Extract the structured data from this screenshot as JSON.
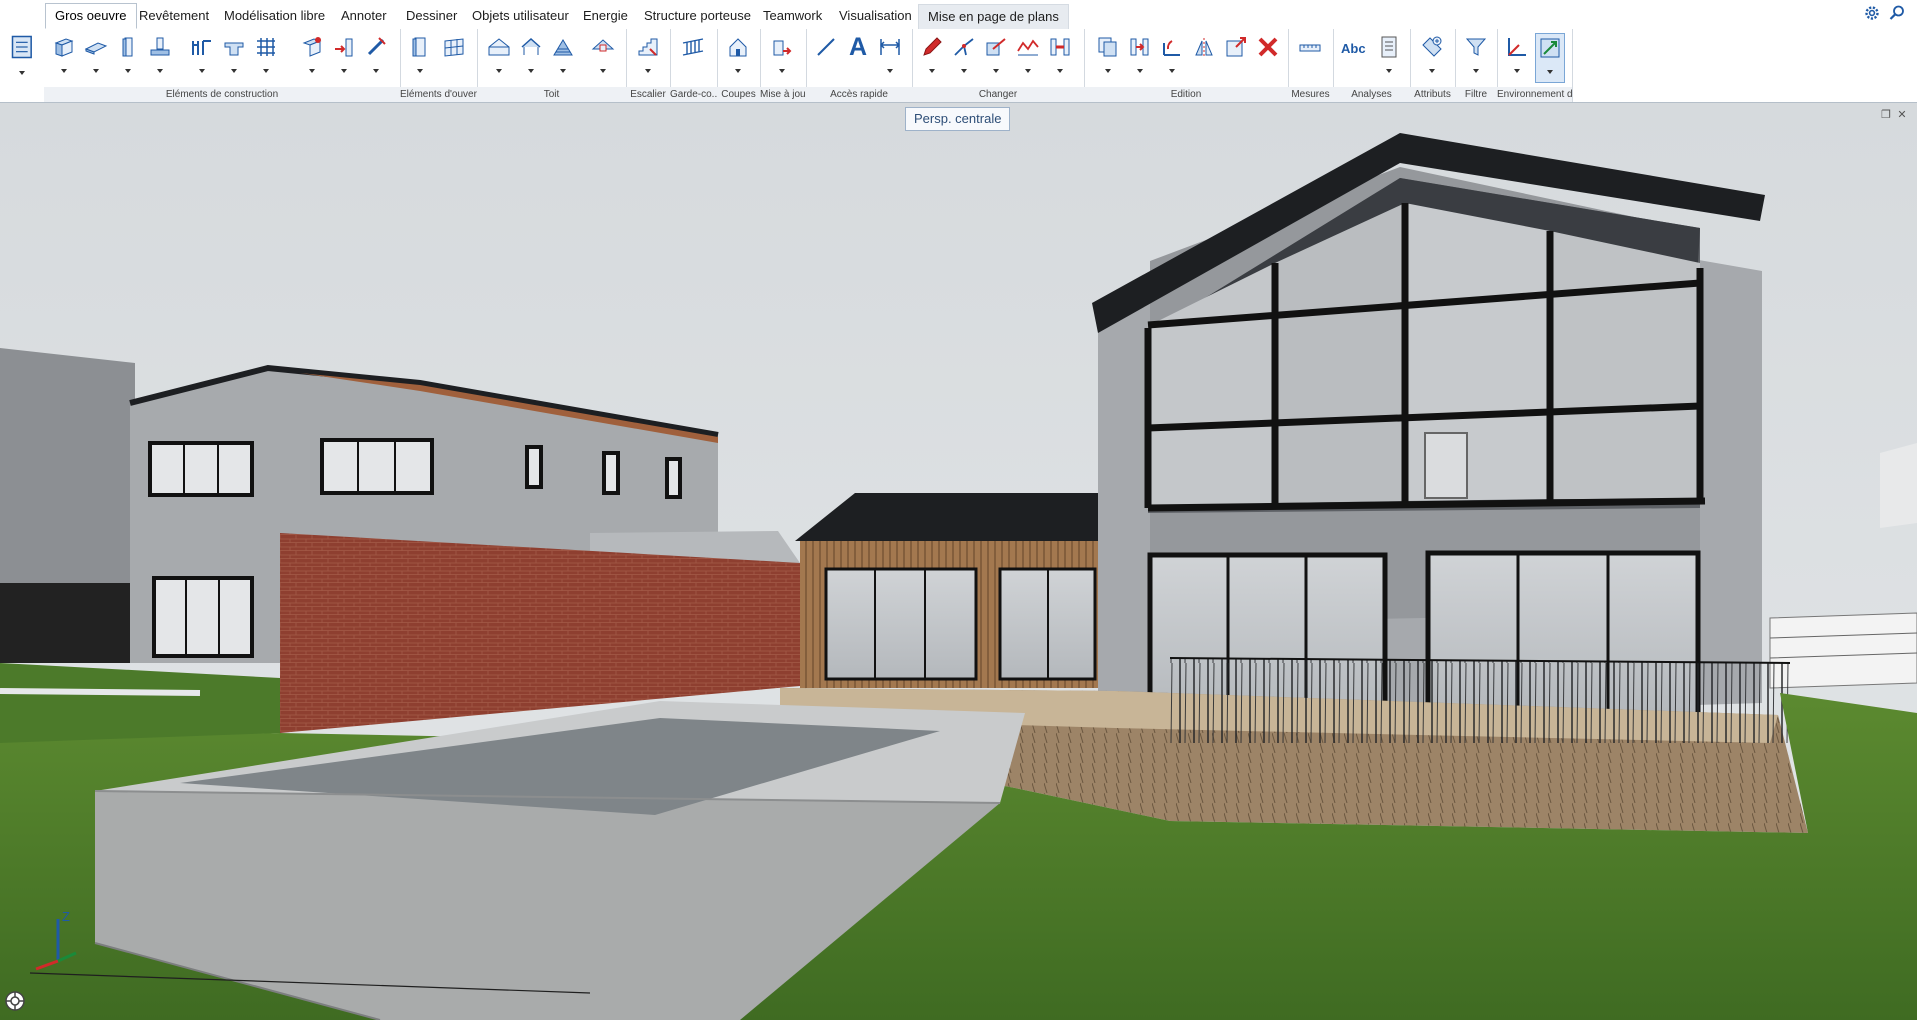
{
  "tabs": [
    {
      "id": "gros-oeuvre",
      "label": "Gros oeuvre",
      "active": true
    },
    {
      "id": "revetement",
      "label": "Revêtement"
    },
    {
      "id": "modelisation-libre",
      "label": "Modélisation libre"
    },
    {
      "id": "annoter",
      "label": "Annoter"
    },
    {
      "id": "dessiner",
      "label": "Dessiner"
    },
    {
      "id": "objets-utilisateur",
      "label": "Objets utilisateur"
    },
    {
      "id": "energie",
      "label": "Energie"
    },
    {
      "id": "structure-porteuse",
      "label": "Structure porteuse"
    },
    {
      "id": "teamwork",
      "label": "Teamwork"
    },
    {
      "id": "visualisation",
      "label": "Visualisation"
    },
    {
      "id": "mise-en-page-de-plans",
      "label": "Mise en page de plans",
      "highlighted": true
    }
  ],
  "ribbon_groups": [
    {
      "label": "Eléments de construction"
    },
    {
      "label": "Eléments d'ouver..."
    },
    {
      "label": "Toit"
    },
    {
      "label": "Escalier"
    },
    {
      "label": "Garde-co..."
    },
    {
      "label": "Coupes"
    },
    {
      "label": "Mise à jour"
    },
    {
      "label": "Accès rapide"
    },
    {
      "label": "Changer"
    },
    {
      "label": "Edition"
    },
    {
      "label": "Mesures"
    },
    {
      "label": "Analyses"
    },
    {
      "label": "Attributs"
    },
    {
      "label": "Filtre"
    },
    {
      "label": "Environnement d..."
    }
  ],
  "ribbon_text": {
    "text_tool": "A",
    "abc_tool": "Abc"
  },
  "icons": {
    "settings": "gear-icon",
    "search": "search-icon",
    "nav_cube": "navigation-cube-icon",
    "restore": "restore-window-icon",
    "close": "close-icon"
  },
  "tooltip": {
    "text": "Persp. centrale"
  },
  "viewport": {
    "axis_z_label": "Z"
  },
  "colors": {
    "accent": "#1f5aa6",
    "ribbon_group_bg": "#eef1f5",
    "sky": "#d9dde0",
    "grass": "#4f7a2b",
    "brick": "#8e3f30",
    "concrete": "#a9abab",
    "roof": "#1d1f22",
    "wall": "#9c9fa3",
    "delete_red": "#d12a2a"
  }
}
